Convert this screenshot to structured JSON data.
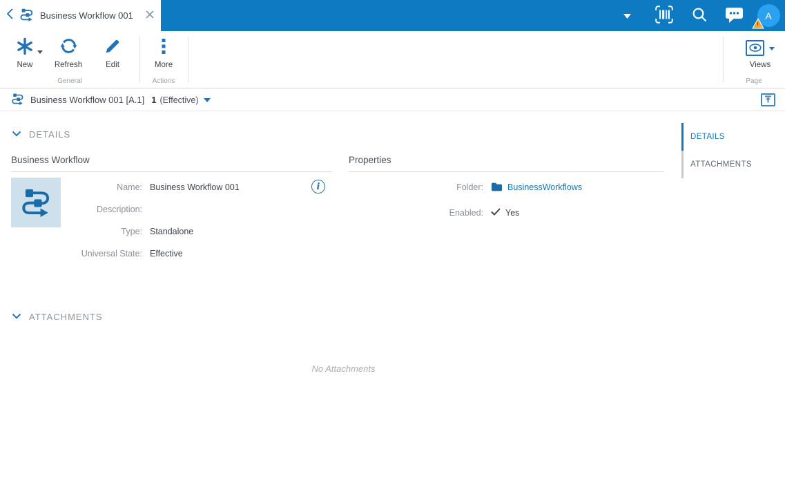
{
  "colors": {
    "header_blue": "#0D7AC2",
    "accent_blue": "#2272B9",
    "link_blue": "#1A75BB",
    "avatar_blue": "#2BA1F2",
    "warning_orange": "#F0A432",
    "thumbnail_bg": "#CEE0EB",
    "glyph_blue": "#1A6CA8"
  },
  "titlebar": {
    "tab": {
      "title": "Business Workflow 001"
    },
    "avatar": {
      "initial": "A",
      "badge": "!"
    }
  },
  "ribbon": {
    "buttons": [
      {
        "label": "New",
        "has_caret": true
      },
      {
        "label": "Refresh"
      },
      {
        "label": "Edit"
      },
      {
        "label": "More"
      }
    ],
    "views_button": {
      "label": "Views",
      "has_caret": true
    },
    "groups": [
      {
        "label": "General"
      },
      {
        "label": "Actions"
      },
      {
        "label": "Page"
      }
    ]
  },
  "item_header": {
    "title": "Business Workflow 001 [A.1]",
    "revision": "1",
    "state": "(Effective)"
  },
  "side_nav": {
    "items": [
      {
        "label": "DETAILS",
        "active": true
      },
      {
        "label": "ATTACHMENTS",
        "active": false
      }
    ]
  },
  "details_section": {
    "label": "DETAILS",
    "form": {
      "heading": "Business Workflow",
      "fields": [
        {
          "label": "Name:",
          "value": "Business Workflow 001"
        },
        {
          "label": "Description:",
          "value": ""
        },
        {
          "label": "Type:",
          "value": "Standalone"
        },
        {
          "label": "Universal State:",
          "value": "Effective"
        }
      ]
    },
    "properties": {
      "heading": "Properties",
      "folder": {
        "label": "Folder:",
        "value": "BusinessWorkflows"
      },
      "enabled": {
        "label": "Enabled:",
        "value": "Yes"
      }
    }
  },
  "attachments_section": {
    "label": "ATTACHMENTS",
    "empty_text": "No Attachments"
  }
}
